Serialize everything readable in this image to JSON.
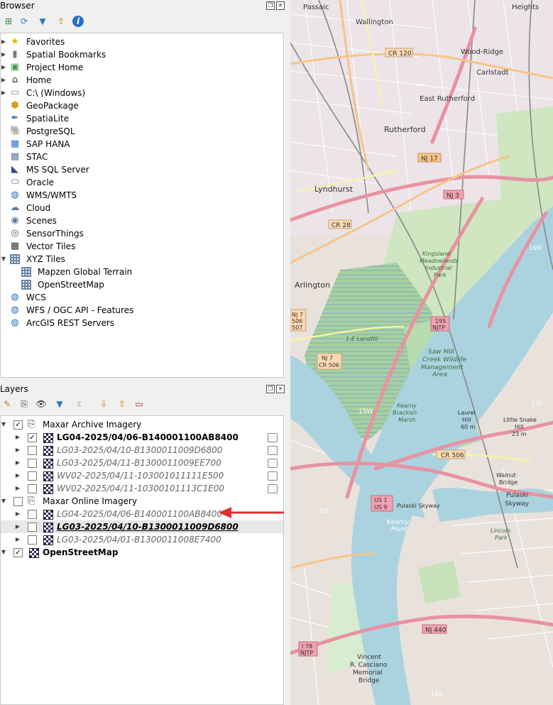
{
  "browser": {
    "title": "Browser",
    "items": [
      {
        "label": "Favorites",
        "icon": "star-icon",
        "expander": true,
        "indent": 0
      },
      {
        "label": "Spatial Bookmarks",
        "icon": "bookmark-icon",
        "expander": true,
        "indent": 0
      },
      {
        "label": "Project Home",
        "icon": "project-home-icon",
        "expander": true,
        "indent": 0
      },
      {
        "label": "Home",
        "icon": "home-icon",
        "expander": true,
        "indent": 0
      },
      {
        "label": "C:\\ (Windows)",
        "icon": "folder-icon",
        "expander": true,
        "indent": 0
      },
      {
        "label": "GeoPackage",
        "icon": "geopackage-icon",
        "expander": false,
        "indent": 0
      },
      {
        "label": "SpatiaLite",
        "icon": "spatialite-icon",
        "expander": false,
        "indent": 0
      },
      {
        "label": "PostgreSQL",
        "icon": "postgresql-icon",
        "expander": false,
        "indent": 0
      },
      {
        "label": "SAP HANA",
        "icon": "sap-hana-icon",
        "expander": false,
        "indent": 0
      },
      {
        "label": "STAC",
        "icon": "stac-icon",
        "expander": false,
        "indent": 0
      },
      {
        "label": "MS SQL Server",
        "icon": "mssql-icon",
        "expander": false,
        "indent": 0
      },
      {
        "label": "Oracle",
        "icon": "oracle-icon",
        "expander": false,
        "indent": 0
      },
      {
        "label": "WMS/WMTS",
        "icon": "wms-icon",
        "expander": false,
        "indent": 0
      },
      {
        "label": "Cloud",
        "icon": "cloud-icon",
        "expander": false,
        "indent": 0
      },
      {
        "label": "Scenes",
        "icon": "scenes-icon",
        "expander": false,
        "indent": 0
      },
      {
        "label": "SensorThings",
        "icon": "sensorthings-icon",
        "expander": false,
        "indent": 0
      },
      {
        "label": "Vector Tiles",
        "icon": "vector-tiles-icon",
        "expander": false,
        "indent": 0
      },
      {
        "label": "XYZ Tiles",
        "icon": "xyz-tiles-icon",
        "expander": "open",
        "indent": 0
      },
      {
        "label": "Mapzen Global Terrain",
        "icon": "xyz-tiles-icon",
        "expander": false,
        "indent": 1
      },
      {
        "label": "OpenStreetMap",
        "icon": "xyz-tiles-icon",
        "expander": false,
        "indent": 1
      },
      {
        "label": "WCS",
        "icon": "wcs-icon",
        "expander": false,
        "indent": 0
      },
      {
        "label": "WFS / OGC API - Features",
        "icon": "wfs-icon",
        "expander": false,
        "indent": 0
      },
      {
        "label": "ArcGIS REST Servers",
        "icon": "arcgis-icon",
        "expander": false,
        "indent": 0
      }
    ]
  },
  "layers": {
    "title": "Layers",
    "groups": [
      {
        "name": "Maxar Archive Imagery",
        "checked": true,
        "children": [
          {
            "name": "LG04-2025/04/06-B140001100AB8400",
            "checked": true,
            "bold": true
          },
          {
            "name": "LG03-2025/04/10-B1300011009D6800",
            "checked": false
          },
          {
            "name": "LG03-2025/04/11-B1300011009EE700",
            "checked": false
          },
          {
            "name": "WV02-2025/04/11-103001011111E500",
            "checked": false
          },
          {
            "name": "WV02-2025/04/11-10300101113C1E00",
            "checked": false
          }
        ]
      },
      {
        "name": "Maxar Online Imagery",
        "checked": false,
        "children": [
          {
            "name": "LG04-2025/04/06-B140001100AB8400",
            "checked": false
          },
          {
            "name": "LG03-2025/04/10-B1300011009D6800",
            "checked": false,
            "selected": true
          },
          {
            "name": "LG03-2025/04/01-B1300011008E7400",
            "checked": false
          }
        ]
      }
    ],
    "basemap": {
      "name": "OpenStreetMap",
      "checked": true
    }
  },
  "map": {
    "places": [
      "Passaic",
      "Heights",
      "Wallington",
      "CR 120",
      "Wood-Ridge",
      "Carlstadt",
      "East Rutherford",
      "Rutherford",
      "NJ 17",
      "Lyndhurst",
      "NJ 3",
      "CR 28",
      "Kingsland Meadowlands Industrial Park",
      "Arlington",
      "NJ 7 506 507",
      "1-E Landfill",
      "195 NJTP",
      "Saw Mill Creek Wildlife Management Area",
      "NJ 7 CR 506",
      "Kearny Brackish Marsh",
      "15W",
      "Laurel Hill 60 m",
      "Little Snake Hill 23 m",
      "CR 506",
      "Walnut Bridge",
      "US 1 US 9",
      "Pulaski Skyway",
      "Kearny Point",
      "Lincoln Park",
      "NJ 440",
      "Vincent R. Casciano Memorial Bridge",
      "I 78 NJTP",
      "16W",
      "15E",
      "17E",
      "14A"
    ]
  },
  "colors": {
    "annotation_arrow": "#e03030",
    "water": "#aad3df",
    "wetland": "#9fc9a0",
    "motorway": "#e892a2"
  }
}
